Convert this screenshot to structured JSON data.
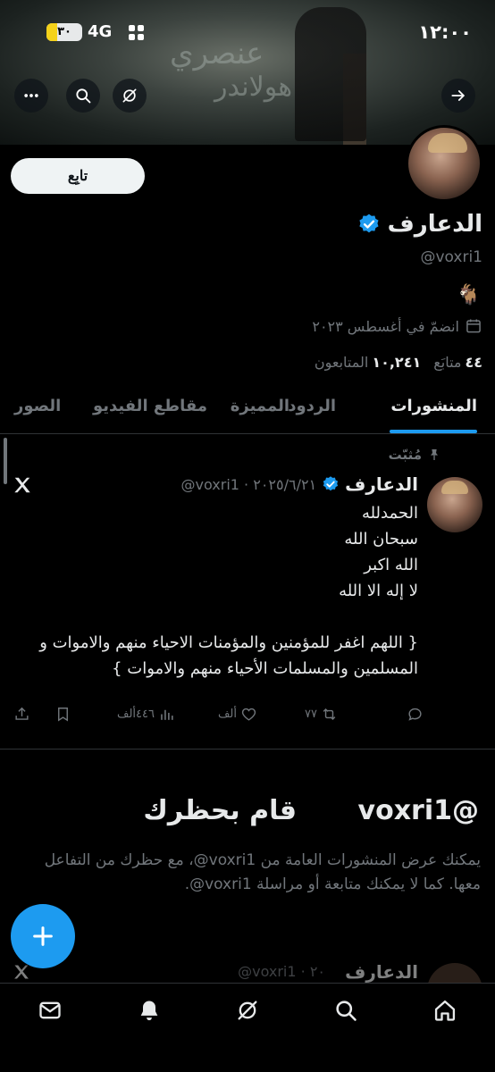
{
  "status_bar": {
    "time": "١٢:٠٠",
    "battery_label": "٣٠",
    "battery_level": 0.3,
    "network": "4G"
  },
  "banner": {
    "wall_text_1": "عنصري",
    "wall_text_2": "هولاندر"
  },
  "profile": {
    "name": "الدعارف",
    "handle": "@voxri1",
    "bio": "🐐",
    "joined": "انضمّ في أغسطس ٢٠٢٣",
    "following_count": "٤٤",
    "following_label": "متابَع",
    "followers_count": "١٠,٢٤١",
    "followers_label": "المتابعون",
    "follow_button": "تابِع"
  },
  "tabs": [
    {
      "label": "المنشورات",
      "active": true
    },
    {
      "label": "الردود",
      "active": false
    },
    {
      "label": "المميزة",
      "active": false
    },
    {
      "label": "مقاطع الفيديو",
      "active": false
    },
    {
      "label": "الصور",
      "active": false
    }
  ],
  "pinned_post": {
    "pinned_label": "مُثبّت",
    "author_name": "الدعارف",
    "meta": "@voxri1 · ٢٠٢٥/٦/٢١",
    "body": "الحمدلله\nسبحان الله\nالله اكبر\nلا إله الا الله\n\n{ اللهم اغفر للمؤمنين والمؤمنات الاحياء منهم والاموات و المسلمين والمسلمات الأحياء منهم والاموات }",
    "reposts": "٧٧",
    "likes": "ألف",
    "views": "٤٤٦ألف"
  },
  "blocked": {
    "title": "قام بحظرك",
    "handle": "@voxri1",
    "text": "يمكنك عرض المنشورات العامة من ‎@voxri1، مع حظرك من التفاعل معها. كما لا يمكنك متابعة أو مراسلة ‎@voxri1."
  },
  "peek_post": {
    "author_name": "الدعارف",
    "meta": "@voxri1 · ٢٠"
  },
  "colors": {
    "accent": "#1d9bf0",
    "background": "#000000",
    "text_primary": "#e7e9ea",
    "text_secondary": "#71767b"
  }
}
